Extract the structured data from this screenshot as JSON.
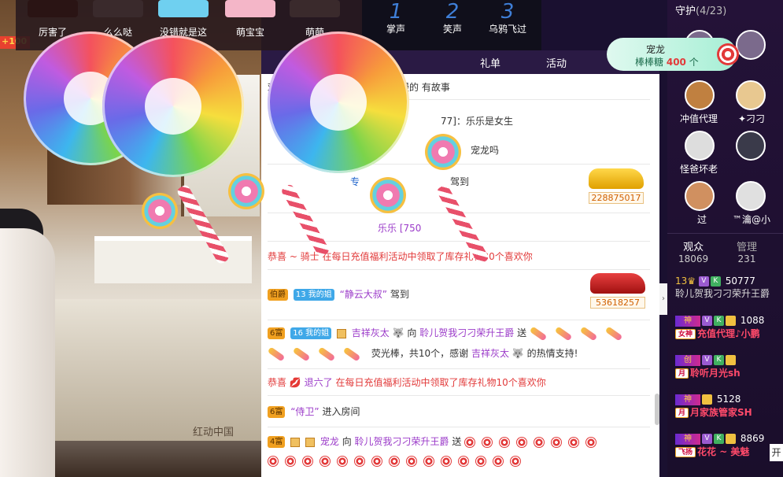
{
  "left_badge": "+100",
  "watermark": "红动中国",
  "emoji_strip": {
    "items": [
      "厉害了",
      "么么哒",
      "没错就是这样",
      "萌宝宝",
      "萌萌"
    ]
  },
  "voice_strip": {
    "items": [
      {
        "num": "1",
        "label": "掌声"
      },
      {
        "num": "2",
        "label": "笑声"
      },
      {
        "num": "3",
        "label": "乌鸦飞过"
      }
    ]
  },
  "chat_tabs": [
    "礼单",
    "活动"
  ],
  "chat": {
    "lines": [
      "欢越来越有味道了，而是我们慢慢的 有故事",
      "77]：乐乐是女生",
      "宠龙吗",
      "专",
      "乐乐 [750",
      "恭喜 ~ 骑士 在每日充值福利活动中领取了库存礼物30个喜欢你",
      "驾到"
    ],
    "car1_num": "228875017",
    "car2_num": "53618257",
    "msg_jingyun_lvl": "伯爵",
    "msg_jingyun_fan": "13 我的姐",
    "msg_jingyun_name": "“静云大叔”",
    "msg_jingyun_action": "驾到",
    "gift1_lvl": "6富",
    "gift1_fan": "16 我的姐",
    "gift1_sender": "吉祥灰太",
    "gift1_to": "向",
    "gift1_receiver": "聆儿贺我刁刁荣升王爵",
    "gift1_send": "送",
    "gift1_desc": "荧光棒，共10个，感谢",
    "gift1_thanks_name": "吉祥灰太",
    "gift1_thanks_tail": "的热情支持!",
    "congrats2_pre": "恭喜",
    "congrats2_name": "退六了",
    "congrats2_text": "在每日充值福利活动中领取了库存礼物10个喜欢你",
    "enter_lvl": "6富",
    "enter_name": "“侍卫”",
    "enter_text": "进入房间",
    "gift2_lvl": "4富",
    "gift2_sender": "宠龙",
    "gift2_to": "向",
    "gift2_receiver": "聆儿贺我刁刁荣升王爵",
    "gift2_send": "送"
  },
  "sidebar": {
    "guard_title": "守护",
    "guard_count": "(4/23)",
    "guards": [
      {
        "name": "冲值代理"
      },
      {
        "name": "✦刁刁"
      },
      {
        "name": "怪爸坏老"
      },
      {
        "name": ""
      },
      {
        "name": "过"
      },
      {
        "name": "™瀹@小"
      }
    ],
    "promo_name": "宠龙",
    "promo_text": "棒棒糖",
    "promo_count": "400",
    "promo_unit": "个",
    "audience_tab": "观众",
    "audience_count": "18069",
    "admin_tab": "管理",
    "admin_count": "231",
    "rows": [
      {
        "lvl": "13",
        "num": "50777",
        "name": "聆儿贺我刁刁荣升王爵"
      },
      {
        "tag": "女神",
        "num": "1088",
        "name": "充值代理♪小鹏"
      },
      {
        "tag": "",
        "num": "",
        "name": "聆听月光sh"
      },
      {
        "tag": "",
        "num": "5128",
        "name": "月家族管家SH"
      },
      {
        "tag": "飞扬",
        "num": "8869",
        "name": "花花 ~ 美魅"
      }
    ]
  },
  "open_button": "开",
  "colors": {
    "accent_red": "#e23a3a",
    "purple_text": "#9b3bc9",
    "sidebar_bg": "#241238"
  }
}
